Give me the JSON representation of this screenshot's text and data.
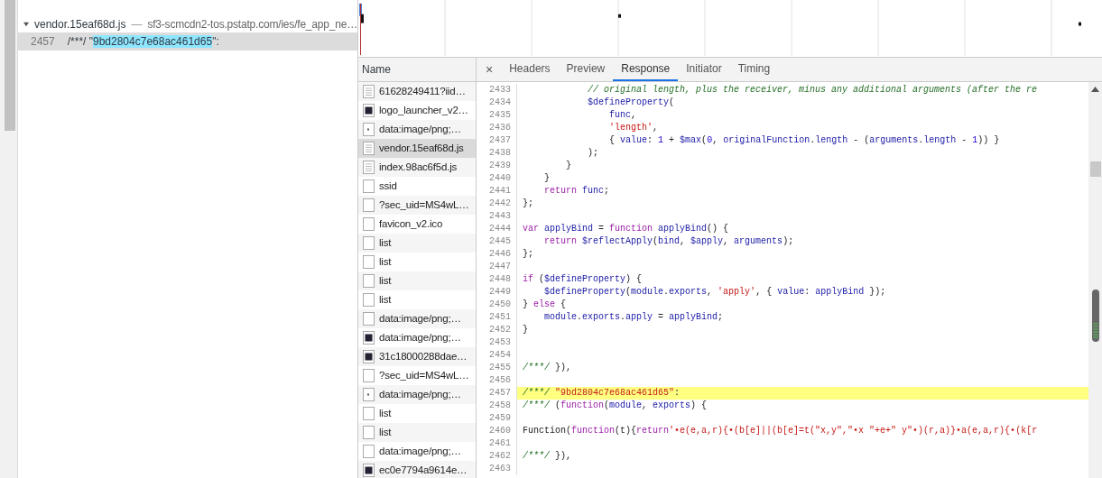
{
  "search_results": {
    "file": {
      "name": "vendor.15eaf68d.js",
      "separator": "—",
      "url": "sf3-scmcdn2-tos.pstatp.com/ies/fe_app_ne…",
      "expanded": true
    },
    "matches": [
      {
        "line": "2457",
        "before": "/***/ \"",
        "match": "9bd2804c7e68ac461d65",
        "after": "\":",
        "selected": true
      }
    ]
  },
  "requests": {
    "header": "Name",
    "items": [
      {
        "name": "61628249411?iid…",
        "kind": "document",
        "selected": false
      },
      {
        "name": "logo_launcher_v2…",
        "kind": "image",
        "selected": false
      },
      {
        "name": "data:image/png;…",
        "kind": "dot",
        "selected": false
      },
      {
        "name": "vendor.15eaf68d.js",
        "kind": "document",
        "selected": true
      },
      {
        "name": "index.98ac6f5d.js",
        "kind": "document",
        "selected": false
      },
      {
        "name": "ssid",
        "kind": "blank",
        "selected": false
      },
      {
        "name": "?sec_uid=MS4wL…",
        "kind": "blank",
        "selected": false
      },
      {
        "name": "favicon_v2.ico",
        "kind": "blank",
        "selected": false
      },
      {
        "name": "list",
        "kind": "blank",
        "selected": false
      },
      {
        "name": "list",
        "kind": "blank",
        "selected": false
      },
      {
        "name": "list",
        "kind": "blank",
        "selected": false
      },
      {
        "name": "list",
        "kind": "blank",
        "selected": false
      },
      {
        "name": "data:image/png;…",
        "kind": "blank",
        "selected": false
      },
      {
        "name": "data:image/png;…",
        "kind": "image",
        "selected": false
      },
      {
        "name": "31c18000288dae…",
        "kind": "image",
        "selected": false
      },
      {
        "name": "?sec_uid=MS4wL…",
        "kind": "blank",
        "selected": false
      },
      {
        "name": "data:image/png;…",
        "kind": "dot",
        "selected": false
      },
      {
        "name": "list",
        "kind": "blank",
        "selected": false
      },
      {
        "name": "list",
        "kind": "blank",
        "selected": false
      },
      {
        "name": "data:image/png;…",
        "kind": "blank",
        "selected": false
      },
      {
        "name": "ec0e7794a9614e…",
        "kind": "image",
        "selected": false
      }
    ]
  },
  "detail": {
    "close": "×",
    "tabs": [
      {
        "label": "Headers",
        "selected": false
      },
      {
        "label": "Preview",
        "selected": false
      },
      {
        "label": "Response",
        "selected": true
      },
      {
        "label": "Initiator",
        "selected": false
      },
      {
        "label": "Timing",
        "selected": false
      }
    ],
    "lines": [
      {
        "number": "2433",
        "highlighted": false,
        "segments": [
          {
            "kind": "comment",
            "text": "            // original length, plus the receiver, minus any additional arguments (after the re"
          }
        ]
      },
      {
        "number": "2434",
        "highlighted": false,
        "segments": [
          {
            "kind": "name",
            "text": "            $defineProperty"
          },
          {
            "kind": "plain",
            "text": "("
          }
        ]
      },
      {
        "number": "2435",
        "highlighted": false,
        "segments": [
          {
            "kind": "name",
            "text": "                func"
          },
          {
            "kind": "plain",
            "text": ","
          }
        ]
      },
      {
        "number": "2436",
        "highlighted": false,
        "segments": [
          {
            "kind": "string",
            "text": "                'length'"
          },
          {
            "kind": "plain",
            "text": ","
          }
        ]
      },
      {
        "number": "2437",
        "highlighted": false,
        "segments": [
          {
            "kind": "plain",
            "text": "                { "
          },
          {
            "kind": "name",
            "text": "value"
          },
          {
            "kind": "plain",
            "text": ": "
          },
          {
            "kind": "number",
            "text": "1"
          },
          {
            "kind": "plain",
            "text": " + "
          },
          {
            "kind": "name",
            "text": "$max"
          },
          {
            "kind": "plain",
            "text": "("
          },
          {
            "kind": "number",
            "text": "0"
          },
          {
            "kind": "plain",
            "text": ", "
          },
          {
            "kind": "name",
            "text": "originalFunction"
          },
          {
            "kind": "plain",
            "text": "."
          },
          {
            "kind": "name",
            "text": "length"
          },
          {
            "kind": "plain",
            "text": " - ("
          },
          {
            "kind": "name",
            "text": "arguments"
          },
          {
            "kind": "plain",
            "text": "."
          },
          {
            "kind": "name",
            "text": "length"
          },
          {
            "kind": "plain",
            "text": " - "
          },
          {
            "kind": "number",
            "text": "1"
          },
          {
            "kind": "plain",
            "text": ")) }"
          }
        ]
      },
      {
        "number": "2438",
        "highlighted": false,
        "segments": [
          {
            "kind": "plain",
            "text": "            );"
          }
        ]
      },
      {
        "number": "2439",
        "highlighted": false,
        "segments": [
          {
            "kind": "plain",
            "text": "        }"
          }
        ]
      },
      {
        "number": "2440",
        "highlighted": false,
        "segments": [
          {
            "kind": "plain",
            "text": "    }"
          }
        ]
      },
      {
        "number": "2441",
        "highlighted": false,
        "segments": [
          {
            "kind": "keyword",
            "text": "    return "
          },
          {
            "kind": "name",
            "text": "func"
          },
          {
            "kind": "plain",
            "text": ";"
          }
        ]
      },
      {
        "number": "2442",
        "highlighted": false,
        "segments": [
          {
            "kind": "plain",
            "text": "};"
          }
        ]
      },
      {
        "number": "2443",
        "highlighted": false
      },
      {
        "number": "2444",
        "highlighted": false,
        "segments": [
          {
            "kind": "keyword",
            "text": "var "
          },
          {
            "kind": "name",
            "text": "applyBind"
          },
          {
            "kind": "plain",
            "text": " = "
          },
          {
            "kind": "keyword",
            "text": "function "
          },
          {
            "kind": "name",
            "text": "applyBind"
          },
          {
            "kind": "plain",
            "text": "() {"
          }
        ]
      },
      {
        "number": "2445",
        "highlighted": false,
        "segments": [
          {
            "kind": "keyword",
            "text": "    return "
          },
          {
            "kind": "name",
            "text": "$reflectApply"
          },
          {
            "kind": "plain",
            "text": "("
          },
          {
            "kind": "name",
            "text": "bind"
          },
          {
            "kind": "plain",
            "text": ", "
          },
          {
            "kind": "name",
            "text": "$apply"
          },
          {
            "kind": "plain",
            "text": ", "
          },
          {
            "kind": "name",
            "text": "arguments"
          },
          {
            "kind": "plain",
            "text": ");"
          }
        ]
      },
      {
        "number": "2446",
        "highlighted": false,
        "segments": [
          {
            "kind": "plain",
            "text": "};"
          }
        ]
      },
      {
        "number": "2447",
        "highlighted": false
      },
      {
        "number": "2448",
        "highlighted": false,
        "segments": [
          {
            "kind": "keyword",
            "text": "if"
          },
          {
            "kind": "plain",
            "text": " ("
          },
          {
            "kind": "name",
            "text": "$defineProperty"
          },
          {
            "kind": "plain",
            "text": ") {"
          }
        ]
      },
      {
        "number": "2449",
        "highlighted": false,
        "segments": [
          {
            "kind": "name",
            "text": "    $defineProperty"
          },
          {
            "kind": "plain",
            "text": "("
          },
          {
            "kind": "name",
            "text": "module"
          },
          {
            "kind": "plain",
            "text": "."
          },
          {
            "kind": "name",
            "text": "exports"
          },
          {
            "kind": "plain",
            "text": ", "
          },
          {
            "kind": "string",
            "text": "'apply'"
          },
          {
            "kind": "plain",
            "text": ", { "
          },
          {
            "kind": "name",
            "text": "value"
          },
          {
            "kind": "plain",
            "text": ": "
          },
          {
            "kind": "name",
            "text": "applyBind"
          },
          {
            "kind": "plain",
            "text": " });"
          }
        ]
      },
      {
        "number": "2450",
        "highlighted": false,
        "segments": [
          {
            "kind": "plain",
            "text": "} "
          },
          {
            "kind": "keyword",
            "text": "else"
          },
          {
            "kind": "plain",
            "text": " {"
          }
        ]
      },
      {
        "number": "2451",
        "highlighted": false,
        "segments": [
          {
            "kind": "name",
            "text": "    module"
          },
          {
            "kind": "plain",
            "text": "."
          },
          {
            "kind": "name",
            "text": "exports"
          },
          {
            "kind": "plain",
            "text": "."
          },
          {
            "kind": "name",
            "text": "apply"
          },
          {
            "kind": "plain",
            "text": " = "
          },
          {
            "kind": "name",
            "text": "applyBind"
          },
          {
            "kind": "plain",
            "text": ";"
          }
        ]
      },
      {
        "number": "2452",
        "highlighted": false,
        "segments": [
          {
            "kind": "plain",
            "text": "}"
          }
        ]
      },
      {
        "number": "2453",
        "highlighted": false
      },
      {
        "number": "2454",
        "highlighted": false
      },
      {
        "number": "2455",
        "highlighted": false,
        "segments": [
          {
            "kind": "comment",
            "text": "/***/"
          },
          {
            "kind": "plain",
            "text": " }),"
          }
        ]
      },
      {
        "number": "2456",
        "highlighted": false
      },
      {
        "number": "2457",
        "highlighted": true,
        "segments": [
          {
            "kind": "comment",
            "text": "/***/ "
          },
          {
            "kind": "string",
            "text": "\"9bd2804c7e68ac461d65\""
          },
          {
            "kind": "plain",
            "text": ":"
          }
        ]
      },
      {
        "number": "2458",
        "highlighted": false,
        "segments": [
          {
            "kind": "comment",
            "text": "/***/"
          },
          {
            "kind": "plain",
            "text": " ("
          },
          {
            "kind": "keyword",
            "text": "function"
          },
          {
            "kind": "plain",
            "text": "("
          },
          {
            "kind": "name",
            "text": "module"
          },
          {
            "kind": "plain",
            "text": ", "
          },
          {
            "kind": "name",
            "text": "exports"
          },
          {
            "kind": "plain",
            "text": ") {"
          }
        ]
      },
      {
        "number": "2459",
        "highlighted": false
      },
      {
        "number": "2460",
        "highlighted": false,
        "segments": [
          {
            "kind": "plain",
            "text": "Function("
          },
          {
            "kind": "keyword",
            "text": "function"
          },
          {
            "kind": "plain",
            "text": "(t){"
          },
          {
            "kind": "keyword",
            "text": "return"
          },
          {
            "kind": "string",
            "text": "'•e(e,a,r){•(b[e]||(b[e]=t(\"x,y\",\"•x \"+e+\" y\"•)(r,a)}•a(e,a,r){•(k[r"
          }
        ]
      },
      {
        "number": "2461",
        "highlighted": false
      },
      {
        "number": "2462",
        "highlighted": false,
        "segments": [
          {
            "kind": "comment",
            "text": "/***/"
          },
          {
            "kind": "plain",
            "text": " }),"
          }
        ]
      },
      {
        "number": "2463",
        "highlighted": false
      }
    ]
  }
}
